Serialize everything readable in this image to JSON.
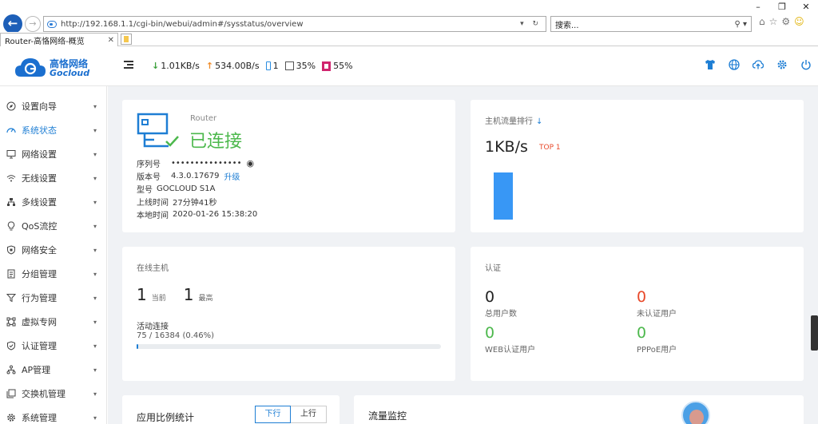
{
  "browser": {
    "url": "http://192.168.1.1/cgi-bin/webui/admin#/sysstatus/overview",
    "search_placeholder": "搜索...",
    "tab_title": "Router-高恪网络-概览"
  },
  "header": {
    "logo_cn": "高恪网络",
    "logo_en": "Gocloud",
    "download_speed": "1.01KB/s",
    "upload_speed": "534.00B/s",
    "devices": "1",
    "cpu": "35%",
    "memory": "55%"
  },
  "sidebar": {
    "items": [
      {
        "label": "设置向导",
        "icon": "compass-icon"
      },
      {
        "label": "系统状态",
        "icon": "dashboard-icon"
      },
      {
        "label": "网络设置",
        "icon": "monitor-icon"
      },
      {
        "label": "无线设置",
        "icon": "wifi-icon"
      },
      {
        "label": "多线设置",
        "icon": "network-icon"
      },
      {
        "label": "QoS流控",
        "icon": "bulb-icon"
      },
      {
        "label": "网络安全",
        "icon": "shield-icon"
      },
      {
        "label": "分组管理",
        "icon": "file-icon"
      },
      {
        "label": "行为管理",
        "icon": "filter-icon"
      },
      {
        "label": "虚拟专网",
        "icon": "vpn-icon"
      },
      {
        "label": "认证管理",
        "icon": "check-shield-icon"
      },
      {
        "label": "AP管理",
        "icon": "ap-icon"
      },
      {
        "label": "交换机管理",
        "icon": "switch-icon"
      },
      {
        "label": "系统管理",
        "icon": "gear-icon"
      }
    ]
  },
  "router": {
    "label": "Router",
    "status": "已连接",
    "serial_key": "序列号",
    "serial_value": "•••••••••••••••",
    "version_key": "版本号",
    "version_value": "4.3.0.17679",
    "upgrade_label": "升级",
    "model_key": "型号",
    "model_value": "GOCLOUD S1A",
    "uptime_key": "上线时间",
    "uptime_value": "27分钟41秒",
    "localtime_key": "本地时间",
    "localtime_value": "2020-01-26 15:38:20"
  },
  "traffic": {
    "title": "主机流量排行",
    "value": "1KB/s",
    "tag": "TOP 1",
    "bar_level": 0.85
  },
  "hosts": {
    "title": "在线主机",
    "current": "1",
    "current_label": "当前",
    "max": "1",
    "max_label": "最高",
    "conn_title": "活动连接",
    "conn_value": "75 / 16384 (0.46%)",
    "conn_fraction": 0.0046
  },
  "auth": {
    "title": "认证",
    "total": "0",
    "total_label": "总用户数",
    "unauth": "0",
    "unauth_label": "未认证用户",
    "web": "0",
    "web_label": "WEB认证用户",
    "pppoe": "0",
    "pppoe_label": "PPPoE用户"
  },
  "apps": {
    "title": "应用比例统计",
    "down_label": "下行",
    "up_label": "上行"
  },
  "monitor": {
    "title": "流量监控"
  },
  "colors": {
    "accent": "#1e7ed4",
    "connected": "#4cb84c",
    "unauth": "#e8492a",
    "bar": "#3897f5"
  }
}
